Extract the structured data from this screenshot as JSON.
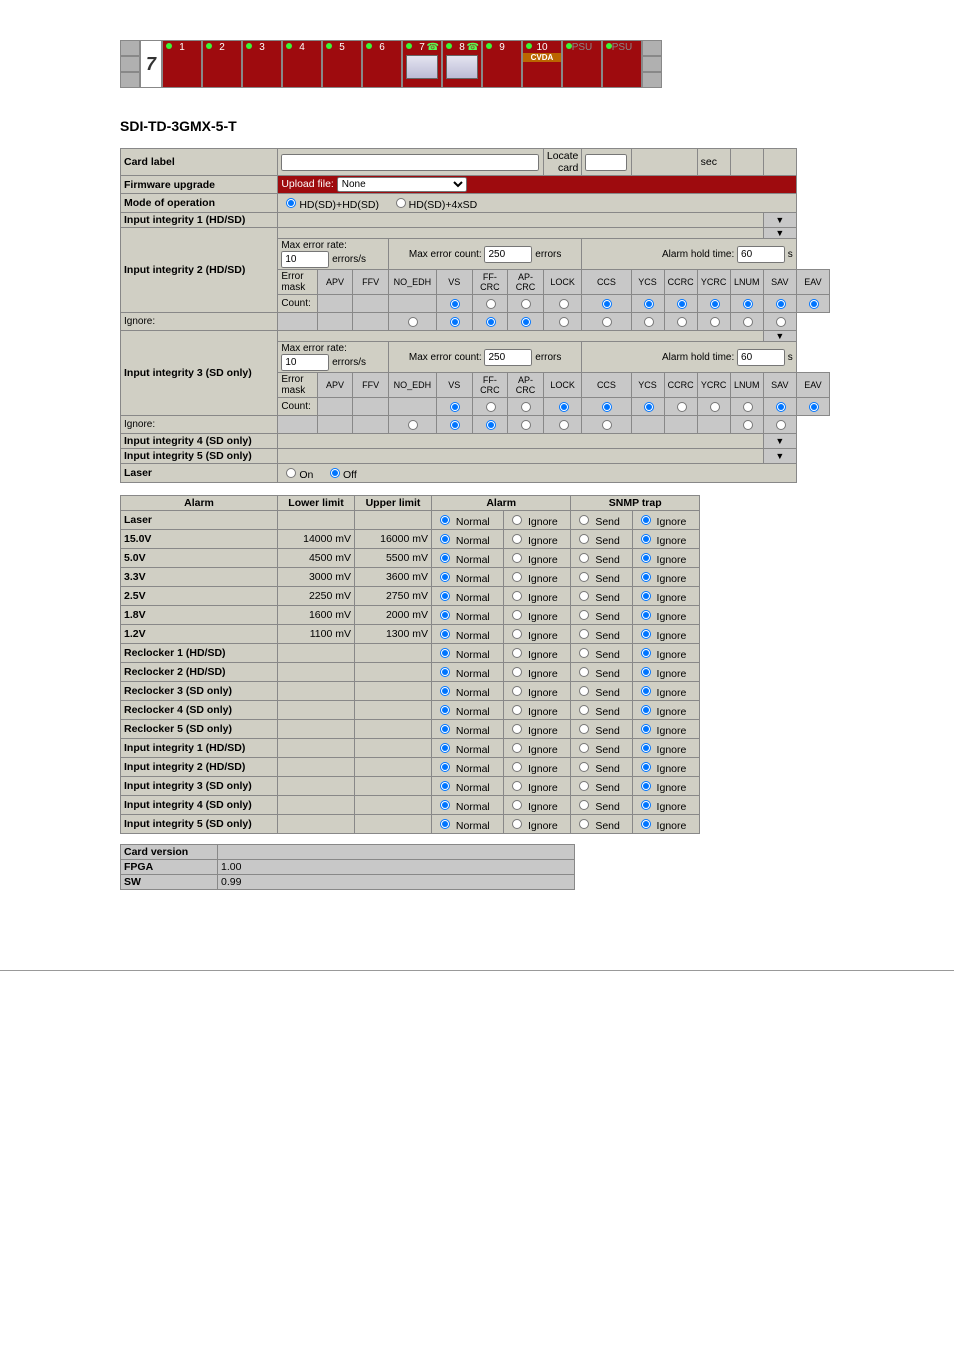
{
  "slots": {
    "big": "7",
    "items": [
      "1",
      "2",
      "3",
      "4",
      "5",
      "6",
      "7",
      "8",
      "9",
      "10",
      "PSU",
      "PSU"
    ],
    "slot7icon": true,
    "slot8icon": true,
    "slot10sub": "CVDA"
  },
  "title": "SDI-TD-3GMX-5-T",
  "cfg": {
    "cardLabel": {
      "label": "Card label",
      "locate": "Locate card",
      "locateVal": "",
      "secVal": "",
      "sec": "sec"
    },
    "fw": {
      "label": "Firmware upgrade",
      "upload": "Upload file:",
      "select": "None"
    },
    "mode": {
      "label": "Mode of operation",
      "a": "HD(SD)+HD(SD)",
      "b": "HD(SD)+4xSD"
    },
    "ii1": {
      "label": "Input integrity 1 (HD/SD)"
    },
    "ii2": {
      "label": "Input integrity 2 (HD/SD)"
    },
    "ii3": {
      "label": "Input integrity 3 (SD only)"
    },
    "ii4": {
      "label": "Input integrity 4 (SD only)"
    },
    "ii5": {
      "label": "Input integrity 5 (SD only)"
    },
    "mer": {
      "label": "Max error rate:",
      "val": "10",
      "unit": "errors/s"
    },
    "mec": {
      "label": "Max error count:",
      "val": "250",
      "unit": "errors"
    },
    "aht": {
      "label": "Alarm hold time:",
      "val": "60",
      "unit": "s"
    },
    "em": {
      "label": "Error mask",
      "cols": [
        "APV",
        "FFV",
        "NO_EDH",
        "VS",
        "FF-CRC",
        "AP-CRC",
        "LOCK",
        "CCS",
        "YCS",
        "CCRC",
        "YCRC",
        "LNUM",
        "SAV",
        "EAV"
      ]
    },
    "count": "Count:",
    "ignore": "Ignore:",
    "laser": {
      "label": "Laser",
      "on": "On",
      "off": "Off"
    }
  },
  "alHead": [
    "Alarm",
    "Lower limit",
    "Upper limit",
    "Alarm",
    "SNMP trap"
  ],
  "alRadio": {
    "normal": "Normal",
    "ignore": "Ignore",
    "send": "Send"
  },
  "alRows": [
    {
      "n": "Laser",
      "l": "",
      "u": ""
    },
    {
      "n": "15.0V",
      "l": "14000 mV",
      "u": "16000 mV"
    },
    {
      "n": "5.0V",
      "l": "4500 mV",
      "u": "5500 mV"
    },
    {
      "n": "3.3V",
      "l": "3000 mV",
      "u": "3600 mV"
    },
    {
      "n": "2.5V",
      "l": "2250 mV",
      "u": "2750 mV"
    },
    {
      "n": "1.8V",
      "l": "1600 mV",
      "u": "2000 mV"
    },
    {
      "n": "1.2V",
      "l": "1100 mV",
      "u": "1300 mV"
    },
    {
      "n": "Reclocker 1 (HD/SD)",
      "l": "",
      "u": ""
    },
    {
      "n": "Reclocker 2 (HD/SD)",
      "l": "",
      "u": ""
    },
    {
      "n": "Reclocker 3 (SD only)",
      "l": "",
      "u": ""
    },
    {
      "n": "Reclocker 4 (SD only)",
      "l": "",
      "u": ""
    },
    {
      "n": "Reclocker 5 (SD only)",
      "l": "",
      "u": ""
    },
    {
      "n": "Input integrity 1 (HD/SD)",
      "l": "",
      "u": ""
    },
    {
      "n": "Input integrity 2 (HD/SD)",
      "l": "",
      "u": ""
    },
    {
      "n": "Input integrity 3 (SD only)",
      "l": "",
      "u": ""
    },
    {
      "n": "Input integrity 4 (SD only)",
      "l": "",
      "u": ""
    },
    {
      "n": "Input integrity 5 (SD only)",
      "l": "",
      "u": ""
    }
  ],
  "ver": {
    "label": "Card version",
    "fpga": "FPGA",
    "fpgaV": "1.00",
    "sw": "SW",
    "swV": "0.99"
  }
}
